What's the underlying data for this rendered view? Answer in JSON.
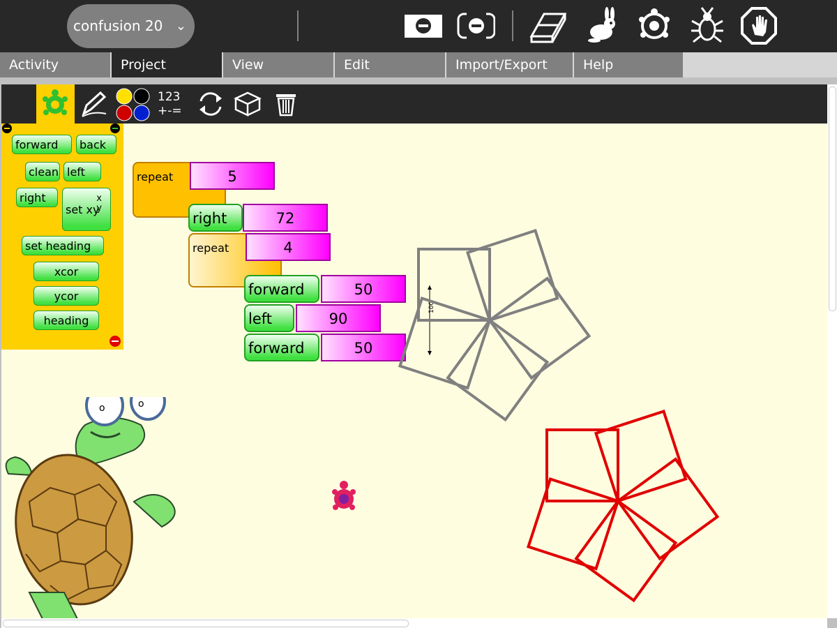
{
  "toolbar": {
    "activity_name": "confusion 20",
    "chevron": "chevron-down-icon",
    "icons": [
      "hide-palette-icon",
      "hide-blocks-icon",
      "eraser-icon",
      "rabbit-run-icon",
      "turtle-run-icon",
      "bug-debug-icon",
      "stop-icon"
    ]
  },
  "menu": {
    "tabs": [
      "Activity",
      "Project",
      "View",
      "Edit",
      "Import/Export",
      "Help"
    ],
    "active": "Project"
  },
  "palette_toolbar": {
    "items": [
      "turtle-palette-icon",
      "pen-palette-icon",
      "colors-palette-icon",
      "numbers-palette-icon",
      "flow-palette-icon",
      "blocks-palette-icon",
      "trash-icon"
    ],
    "numbers_label_top": "123",
    "numbers_label_bottom": "+-=",
    "colors": [
      "#ffe000",
      "#000000",
      "#d00000",
      "#0020d0"
    ]
  },
  "palette_blocks": {
    "forward": "forward",
    "back": "back",
    "clean": "clean",
    "left": "left",
    "right": "right",
    "setxy": "set xy",
    "setxy_x": "x",
    "setxy_y": "y",
    "setheading": "set heading",
    "xcor": "xcor",
    "ycor": "ycor",
    "heading": "heading"
  },
  "program": {
    "repeat_outer_label": "repeat",
    "repeat_outer_count": "5",
    "right_label": "right",
    "right_value": "72",
    "repeat_inner_label": "repeat",
    "repeat_inner_count": "4",
    "forward1_label": "forward",
    "forward1_value": "50",
    "left_label": "left",
    "left_value": "90",
    "forward2_label": "forward",
    "forward2_value": "50"
  },
  "drawing": {
    "scale_label": "100",
    "gray_color": "#808080",
    "red_color": "#e00000"
  }
}
